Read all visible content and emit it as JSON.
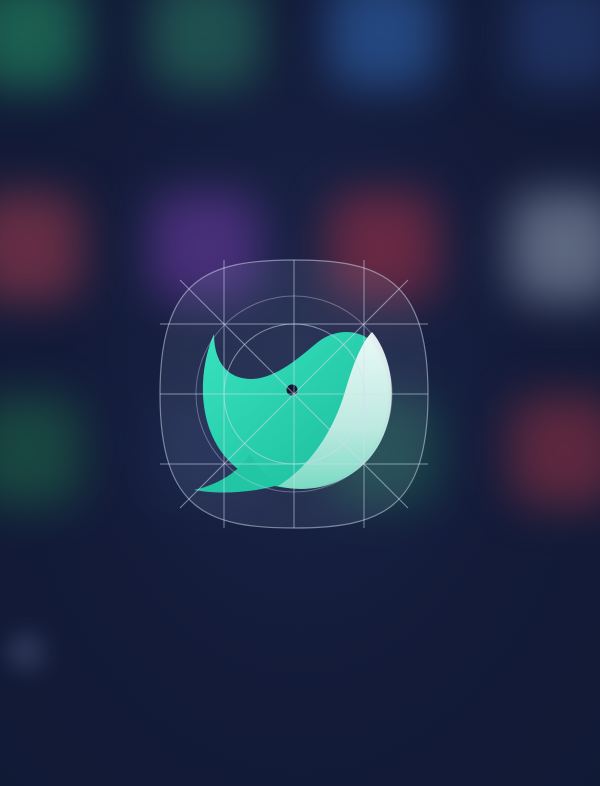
{
  "colors": {
    "background": "#131b39",
    "accent": "#2fd9b4",
    "accent_dark": "#1bbf9f",
    "whale_belly": "#e8f6f3",
    "eye": "#0e1633",
    "keyline": "#c9d2e8"
  },
  "background_apps": [
    {
      "name": "green-app-blur",
      "color": "#1f7d5c"
    },
    {
      "name": "teal-app-blur",
      "color": "#2a7d62"
    },
    {
      "name": "blue-app-blur",
      "color": "#2d5fa6"
    },
    {
      "name": "navy-app-blur",
      "color": "#26407a"
    },
    {
      "name": "red-app-blur",
      "color": "#9c3a4d"
    },
    {
      "name": "purple-app-blur",
      "color": "#6a3aa0"
    },
    {
      "name": "crimson-app-blur",
      "color": "#9e2f45"
    },
    {
      "name": "multicolor-app-blur",
      "color": "#8e9ab0"
    },
    {
      "name": "green-app-blur-2",
      "color": "#1e6a48"
    },
    {
      "name": "red-app-blur-2",
      "color": "#9a3344"
    },
    {
      "name": "dot-blur",
      "color": "#3a4466"
    }
  ],
  "featured_icon": {
    "icon": "whale-icon",
    "grid": "icon-keyline-grid"
  }
}
